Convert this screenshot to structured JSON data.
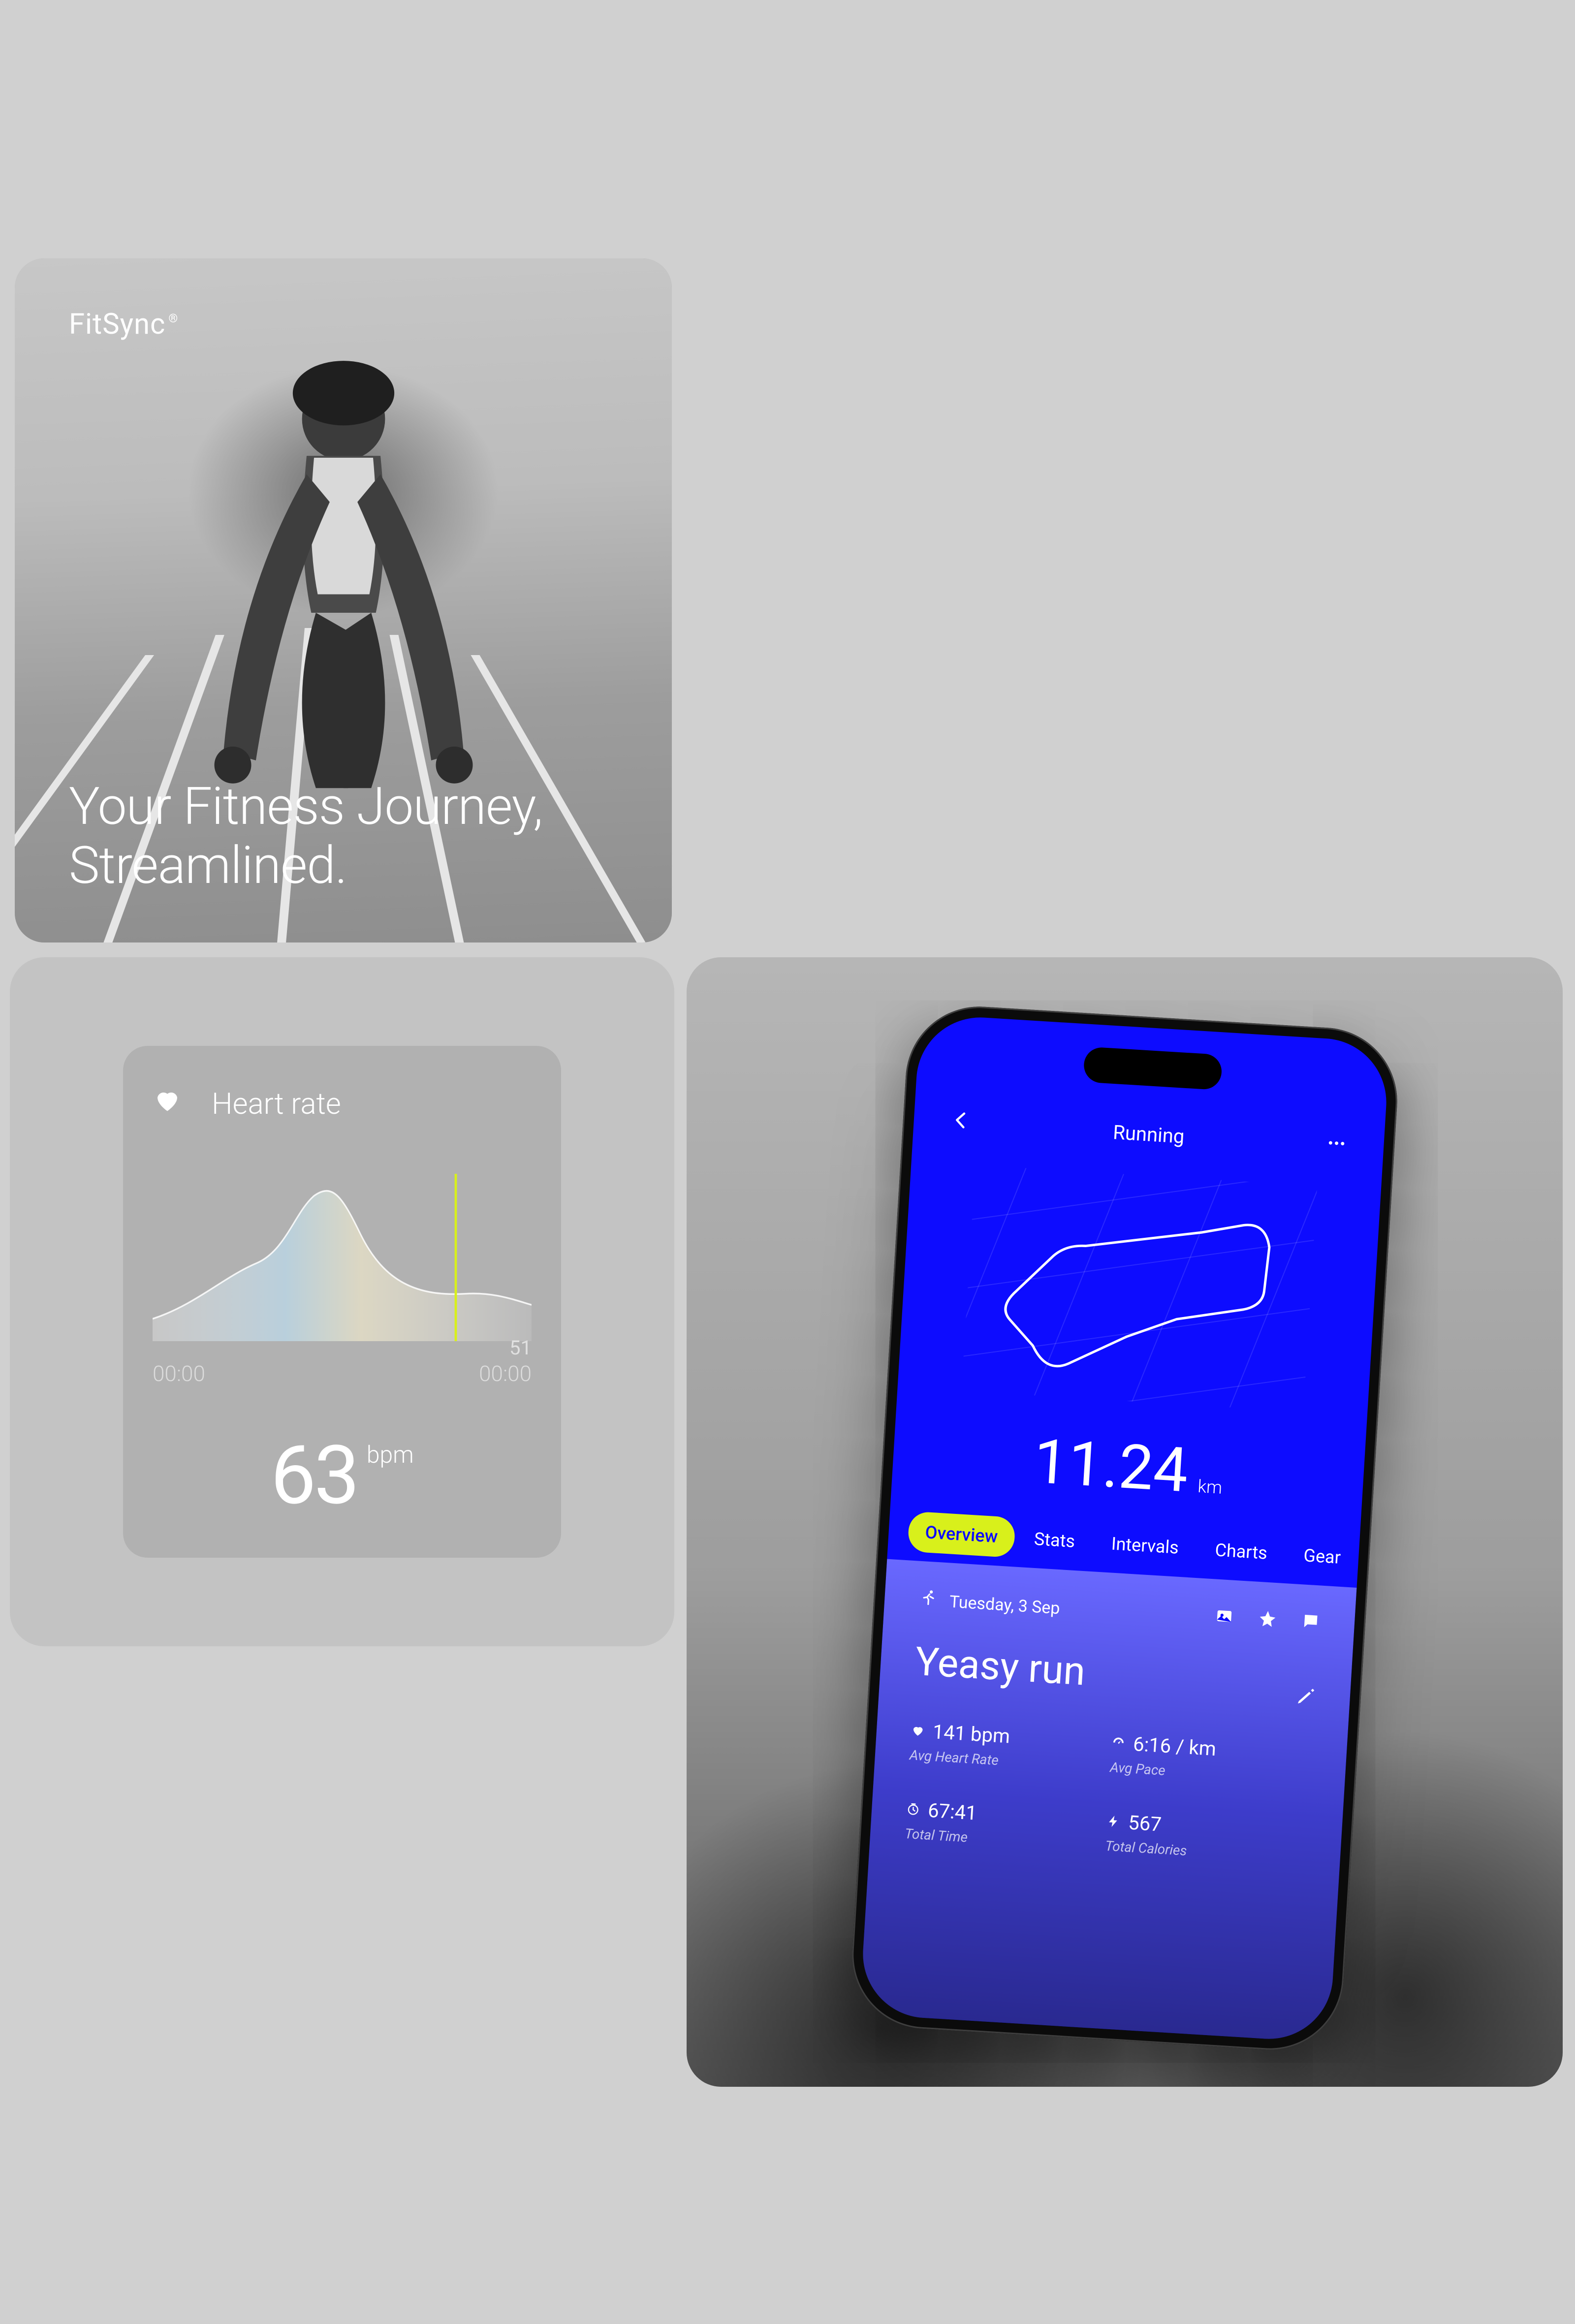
{
  "hero": {
    "brand": "FitSync",
    "brand_mark": "®",
    "tagline_line1": "Your Fitness Journey,",
    "tagline_line2": "Streamlined."
  },
  "heart_rate": {
    "title": "Heart rate",
    "marker_value": "51",
    "time_start": "00:00",
    "time_end": "00:00",
    "value": "63",
    "unit": "bpm"
  },
  "phone": {
    "header_title": "Running",
    "distance_value": "11.24",
    "distance_unit": "km",
    "tabs": {
      "overview": "Overview",
      "stats": "Stats",
      "intervals": "Intervals",
      "charts": "Charts",
      "gear": "Gear"
    },
    "panel": {
      "date": "Tuesday, 3 Sep",
      "title": "Yeasy run",
      "stats": {
        "hr_value": "141 bpm",
        "hr_label": "Avg Heart Rate",
        "pace_value": "6:16 / km",
        "pace_label": "Avg Pace",
        "time_value": "67:41",
        "time_label": "Total Time",
        "cal_value": "567",
        "cal_label": "Total Calories"
      }
    }
  },
  "colors": {
    "accent_blue": "#0d0cff",
    "accent_lime": "#d8f01b"
  }
}
